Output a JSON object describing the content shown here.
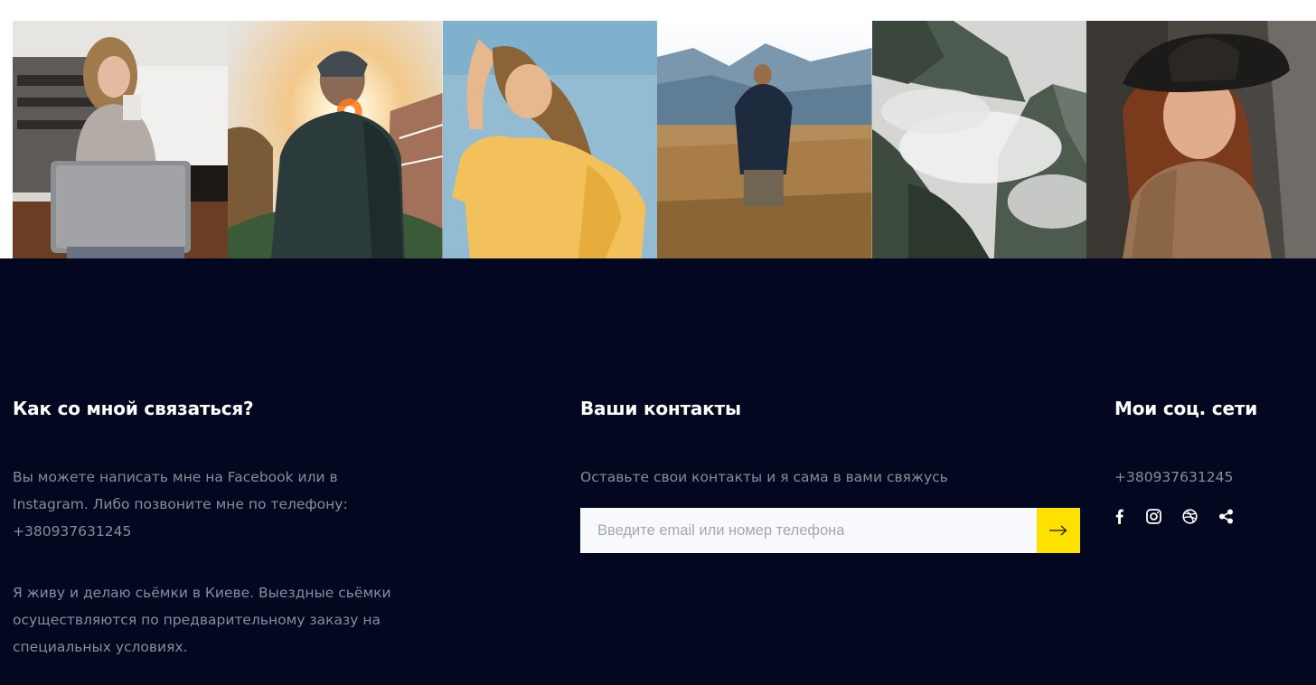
{
  "gallery": {
    "photos": [
      {
        "icon": "woman-with-laptop-photo"
      },
      {
        "icon": "man-in-cap-sunset-photo"
      },
      {
        "icon": "woman-yellow-shirt-photo"
      },
      {
        "icon": "man-in-field-photo"
      },
      {
        "icon": "misty-mountains-photo"
      },
      {
        "icon": "woman-in-hat-photo"
      }
    ]
  },
  "footer": {
    "contact_me": {
      "heading": "Как со мной связаться?",
      "paragraph_1": "Вы можете написать мне на Facebook или в Instagram. Либо позвоните мне по телефону: +380937631245",
      "paragraph_2": "Я живу и делаю сьёмки в Киеве. Выездные сьёмки осуществляются по предварительному заказу на специальных условиях."
    },
    "your_contacts": {
      "heading": "Ваши контакты",
      "description": "Оставьте свои контакты и я сама в вами свяжусь",
      "input_placeholder": "Введите email или номер телефона",
      "input_value": "",
      "submit_icon": "arrow-right-icon"
    },
    "social": {
      "heading": "Мои соц. сети",
      "phone": "+380937631245",
      "icons": [
        "facebook-icon",
        "instagram-icon",
        "dribbble-icon",
        "share-icon"
      ]
    }
  },
  "colors": {
    "footer_background": "#030720",
    "accent": "#ffe100",
    "heading_text": "#ffffff",
    "body_text": "#8a8c99",
    "input_background": "#f8f9fd"
  }
}
